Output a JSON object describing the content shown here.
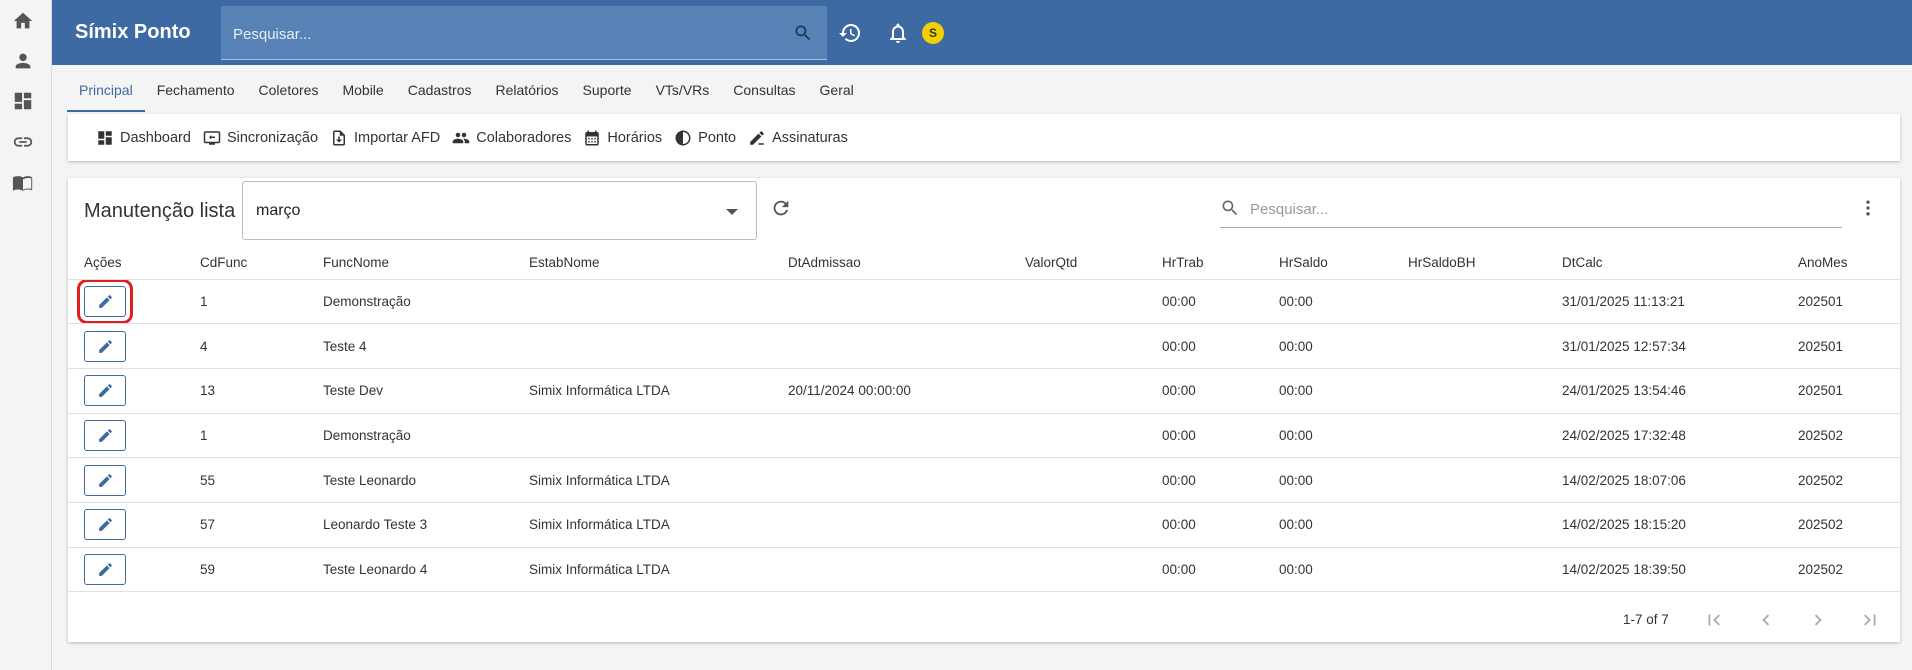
{
  "header": {
    "app_title": "Símix Ponto",
    "search_placeholder": "Pesquisar...",
    "avatar_initial": "S"
  },
  "tabs": [
    {
      "label": "Principal",
      "active": true
    },
    {
      "label": "Fechamento"
    },
    {
      "label": "Coletores"
    },
    {
      "label": "Mobile"
    },
    {
      "label": "Cadastros"
    },
    {
      "label": "Relatórios"
    },
    {
      "label": "Suporte"
    },
    {
      "label": "VTs/VRs"
    },
    {
      "label": "Consultas"
    },
    {
      "label": "Geral"
    }
  ],
  "toolbar": {
    "dashboard": "Dashboard",
    "sincronizacao": "Sincronização",
    "importar_afd": "Importar AFD",
    "colaboradores": "Colaboradores",
    "horarios": "Horários",
    "ponto": "Ponto",
    "assinaturas": "Assinaturas"
  },
  "card": {
    "title": "Manutenção lista",
    "month": "março",
    "search_placeholder": "Pesquisar..."
  },
  "table": {
    "headers": [
      "Ações",
      "CdFunc",
      "FuncNome",
      "EstabNome",
      "DtAdmissao",
      "ValorQtd",
      "HrTrab",
      "HrSaldo",
      "HrSaldoBH",
      "DtCalc",
      "AnoMes"
    ],
    "rows": [
      [
        "1",
        "Demonstração",
        "",
        "",
        "",
        "00:00",
        "00:00",
        "",
        "31/01/2025 11:13:21",
        "202501"
      ],
      [
        "4",
        "Teste 4",
        "",
        "",
        "",
        "00:00",
        "00:00",
        "",
        "31/01/2025 12:57:34",
        "202501"
      ],
      [
        "13",
        "Teste Dev",
        "Simix Informática LTDA",
        "20/11/2024 00:00:00",
        "",
        "00:00",
        "00:00",
        "",
        "24/01/2025 13:54:46",
        "202501"
      ],
      [
        "1",
        "Demonstração",
        "",
        "",
        "",
        "00:00",
        "00:00",
        "",
        "24/02/2025 17:32:48",
        "202502"
      ],
      [
        "55",
        "Teste Leonardo",
        "Simix Informática LTDA",
        "",
        "",
        "00:00",
        "00:00",
        "",
        "14/02/2025 18:07:06",
        "202502"
      ],
      [
        "57",
        "Leonardo Teste 3",
        "Simix Informática LTDA",
        "",
        "",
        "00:00",
        "00:00",
        "",
        "14/02/2025 18:15:20",
        "202502"
      ],
      [
        "59",
        "Teste Leonardo 4",
        "Simix Informática LTDA",
        "",
        "",
        "00:00",
        "00:00",
        "",
        "14/02/2025 18:39:50",
        "202502"
      ]
    ]
  },
  "pager": {
    "range": "1-7 of 7"
  },
  "colors": {
    "header_bg": "#3d6aa3",
    "accent": "#3d6aa3",
    "avatar": "#f5d000",
    "highlight": "#e02020"
  }
}
